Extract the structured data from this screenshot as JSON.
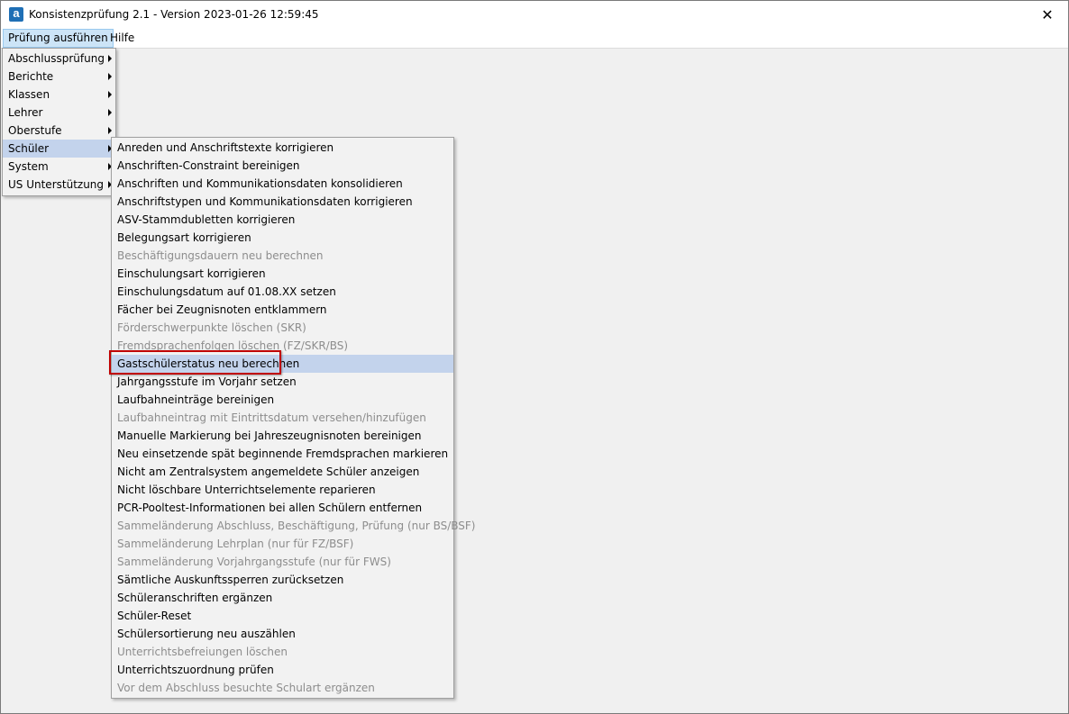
{
  "window": {
    "title": "Konsistenzprüfung 2.1 - Version 2023-01-26 12:59:45",
    "icon": "app-logo-icon",
    "icon_letter": "a"
  },
  "menubar": [
    {
      "label": "Prüfung ausführen"
    },
    {
      "label": "Hilfe"
    }
  ],
  "main_menu": [
    {
      "label": "Abschlussprüfung"
    },
    {
      "label": "Berichte"
    },
    {
      "label": "Klassen"
    },
    {
      "label": "Lehrer"
    },
    {
      "label": "Oberstufe"
    },
    {
      "label": "Schüler"
    },
    {
      "label": "System"
    },
    {
      "label": "US Unterstützung"
    }
  ],
  "main_menu_highlight_index": 5,
  "submenu": [
    {
      "label": "Anreden und Anschriftstexte korrigieren",
      "disabled": false
    },
    {
      "label": "Anschriften-Constraint bereinigen",
      "disabled": false
    },
    {
      "label": "Anschriften und Kommunikationsdaten konsolidieren",
      "disabled": false
    },
    {
      "label": "Anschriftstypen und Kommunikationsdaten korrigieren",
      "disabled": false
    },
    {
      "label": "ASV-Stammdubletten korrigieren",
      "disabled": false
    },
    {
      "label": "Belegungsart korrigieren",
      "disabled": false
    },
    {
      "label": "Beschäftigungsdauern neu berechnen",
      "disabled": true
    },
    {
      "label": "Einschulungsart korrigieren",
      "disabled": false
    },
    {
      "label": "Einschulungsdatum auf 01.08.XX setzen",
      "disabled": false
    },
    {
      "label": "Fächer bei Zeugnisnoten entklammern",
      "disabled": false
    },
    {
      "label": "Förderschwerpunkte löschen (SKR)",
      "disabled": true
    },
    {
      "label": "Fremdsprachenfolgen löschen (FZ/SKR/BS)",
      "disabled": true
    },
    {
      "label": "Gastschülerstatus neu berechnen",
      "disabled": false
    },
    {
      "label": "Jahrgangsstufe im Vorjahr setzen",
      "disabled": false
    },
    {
      "label": "Laufbahneinträge bereinigen",
      "disabled": false
    },
    {
      "label": "Laufbahneintrag mit Eintrittsdatum versehen/hinzufügen",
      "disabled": true
    },
    {
      "label": "Manuelle Markierung bei Jahreszeugnisnoten bereinigen",
      "disabled": false
    },
    {
      "label": "Neu einsetzende spät beginnende Fremdsprachen markieren",
      "disabled": false
    },
    {
      "label": "Nicht am Zentralsystem angemeldete Schüler anzeigen",
      "disabled": false
    },
    {
      "label": "Nicht löschbare Unterrichtselemente reparieren",
      "disabled": false
    },
    {
      "label": "PCR-Pooltest-Informationen bei allen Schülern entfernen",
      "disabled": false
    },
    {
      "label": "Sammeländerung Abschluss, Beschäftigung, Prüfung (nur BS/BSF)",
      "disabled": true
    },
    {
      "label": "Sammeländerung Lehrplan (nur für FZ/BSF)",
      "disabled": true
    },
    {
      "label": "Sammeländerung Vorjahrgangsstufe (nur für FWS)",
      "disabled": true
    },
    {
      "label": "Sämtliche Auskunftssperren zurücksetzen",
      "disabled": false
    },
    {
      "label": "Schüleranschriften ergänzen",
      "disabled": false
    },
    {
      "label": "Schüler-Reset",
      "disabled": false
    },
    {
      "label": "Schülersortierung neu auszählen",
      "disabled": false
    },
    {
      "label": "Unterrichtsbefreiungen löschen",
      "disabled": true
    },
    {
      "label": "Unterrichtszuordnung prüfen",
      "disabled": false
    },
    {
      "label": "Vor dem Abschluss besuchte Schulart ergänzen",
      "disabled": true
    }
  ],
  "submenu_highlight_index": 12,
  "colors": {
    "highlight": "#c3d3ec",
    "disabled_text": "#8d8d8d",
    "callout_border": "#c00000"
  }
}
